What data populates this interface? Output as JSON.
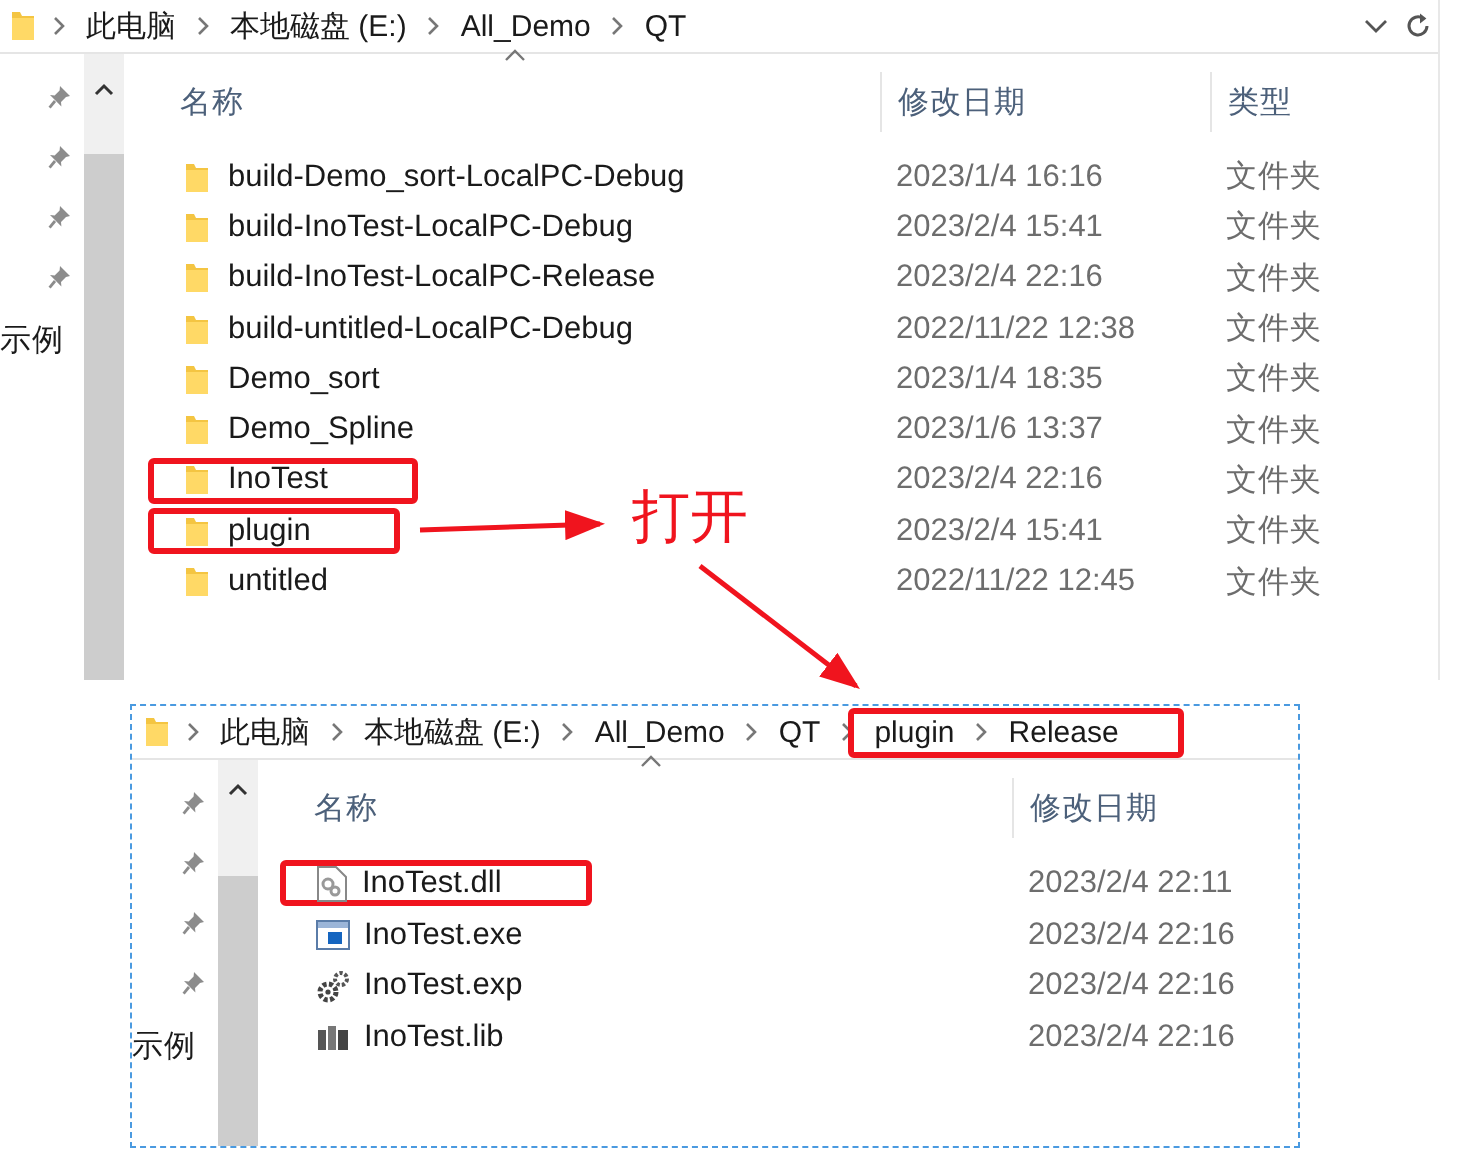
{
  "top_window": {
    "breadcrumb": [
      {
        "label": "此电脑",
        "highlighted": false
      },
      {
        "label": "本地磁盘 (E:)",
        "highlighted": false
      },
      {
        "label": "All_Demo",
        "highlighted": false
      },
      {
        "label": "QT",
        "highlighted": false
      }
    ],
    "navigation_label": "示例",
    "columns": [
      {
        "label": "名称",
        "sorted": true
      },
      {
        "label": "修改日期",
        "sorted": false
      },
      {
        "label": "类型",
        "sorted": false
      }
    ],
    "rows": [
      {
        "kind": "folder",
        "name": "build-Demo_sort-LocalPC-Debug",
        "date": "2023/1/4 16:16",
        "type": "文件夹",
        "highlighted": false
      },
      {
        "kind": "folder",
        "name": "build-InoTest-LocalPC-Debug",
        "date": "2023/2/4 15:41",
        "type": "文件夹",
        "highlighted": false
      },
      {
        "kind": "folder",
        "name": "build-InoTest-LocalPC-Release",
        "date": "2023/2/4 22:16",
        "type": "文件夹",
        "highlighted": false
      },
      {
        "kind": "folder",
        "name": "build-untitled-LocalPC-Debug",
        "date": "2022/11/22 12:38",
        "type": "文件夹",
        "highlighted": false
      },
      {
        "kind": "folder",
        "name": "Demo_sort",
        "date": "2023/1/4 18:35",
        "type": "文件夹",
        "highlighted": false
      },
      {
        "kind": "folder",
        "name": "Demo_Spline",
        "date": "2023/1/6 13:37",
        "type": "文件夹",
        "highlighted": false
      },
      {
        "kind": "folder",
        "name": "InoTest",
        "date": "2023/2/4 22:16",
        "type": "文件夹",
        "highlighted": true
      },
      {
        "kind": "folder",
        "name": "plugin",
        "date": "2023/2/4 15:41",
        "type": "文件夹",
        "highlighted": true
      },
      {
        "kind": "folder",
        "name": "untitled",
        "date": "2022/11/22 12:45",
        "type": "文件夹",
        "highlighted": false
      }
    ]
  },
  "annotation": {
    "label": "打开"
  },
  "bottom_window": {
    "breadcrumb": [
      {
        "label": "此电脑",
        "highlighted": false
      },
      {
        "label": "本地磁盘 (E:)",
        "highlighted": false
      },
      {
        "label": "All_Demo",
        "highlighted": false
      },
      {
        "label": "QT",
        "highlighted": false
      },
      {
        "label": "plugin",
        "highlighted": true
      },
      {
        "label": "Release",
        "highlighted": true
      }
    ],
    "navigation_label": "示例",
    "columns": [
      {
        "label": "名称",
        "sorted": true
      },
      {
        "label": "修改日期",
        "sorted": false
      }
    ],
    "rows": [
      {
        "kind": "dll",
        "name": "InoTest.dll",
        "date": "2023/2/4 22:11",
        "highlighted": true
      },
      {
        "kind": "exe",
        "name": "InoTest.exe",
        "date": "2023/2/4 22:16",
        "highlighted": false
      },
      {
        "kind": "exp",
        "name": "InoTest.exp",
        "date": "2023/2/4 22:16",
        "highlighted": false
      },
      {
        "kind": "lib",
        "name": "InoTest.lib",
        "date": "2023/2/4 22:16",
        "highlighted": false
      }
    ]
  }
}
